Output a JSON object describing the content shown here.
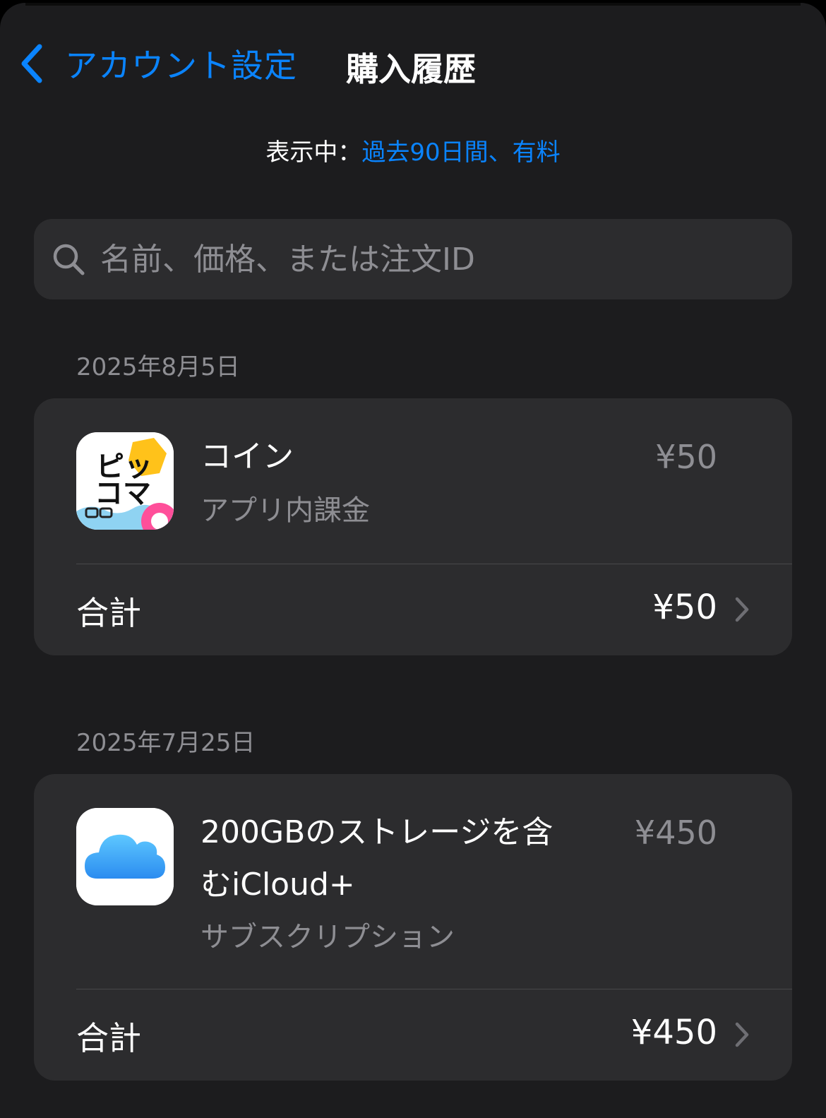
{
  "nav": {
    "back_label": "アカウント設定",
    "title": "購入履歴"
  },
  "filter": {
    "label": "表示中：",
    "value": "過去90日間、有料"
  },
  "search": {
    "placeholder": "名前、価格、または注文ID"
  },
  "accent_color": "#0a84ff",
  "purchases": [
    {
      "date": "2025年8月5日",
      "icon": "piccoma-app-icon",
      "icon_text": [
        "ピッ",
        "コマ"
      ],
      "name": "コイン",
      "type": "アプリ内課金",
      "price": "¥50",
      "total_label": "合計",
      "total": "¥50"
    },
    {
      "date": "2025年7月25日",
      "icon": "icloud-app-icon",
      "name_lines": [
        "200GBのストレージを含",
        "むiCloud+"
      ],
      "type": "サブスクリプション",
      "price": "¥450",
      "total_label": "合計",
      "total": "¥450"
    }
  ]
}
